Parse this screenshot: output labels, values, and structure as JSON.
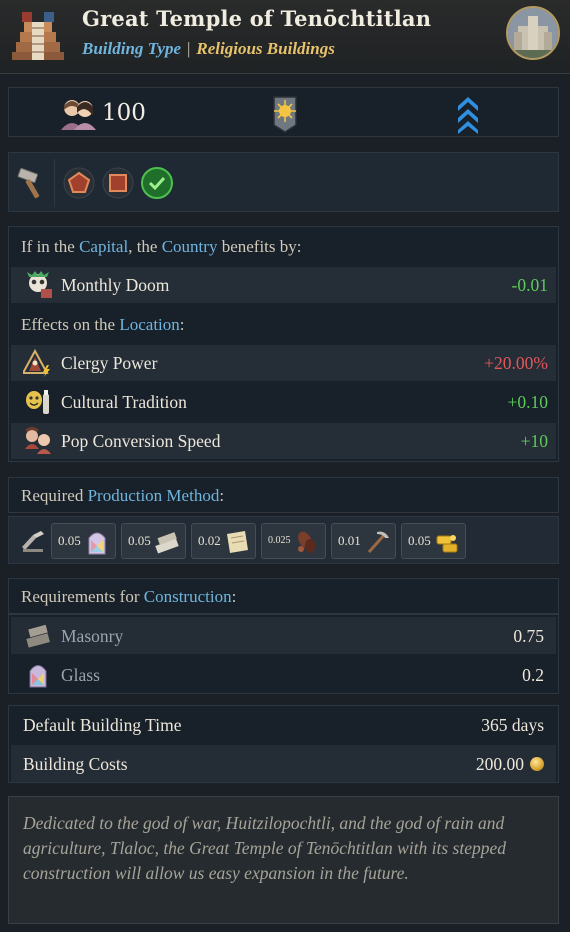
{
  "header": {
    "title": "Great Temple of Tenōchtitlan",
    "type_label": "Building Type",
    "type_value": "Religious Buildings"
  },
  "stats": {
    "population": "100"
  },
  "effects": {
    "capital_prefix": "If in the ",
    "capital_word": "Capital",
    "capital_mid": ", the ",
    "country_word": "Country",
    "capital_suffix": " benefits by:",
    "country_rows": [
      {
        "label": "Monthly Doom",
        "value": "-0.01",
        "icon": "doom-icon"
      }
    ],
    "location_prefix": "Effects on the ",
    "location_word": "Location",
    "location_suffix": ":",
    "location_rows": [
      {
        "label": "Clergy Power",
        "value": "+20.00%",
        "icon": "clergy-icon"
      },
      {
        "label": "Cultural Tradition",
        "value": "+0.10",
        "icon": "culture-icon"
      },
      {
        "label": "Pop Conversion Speed",
        "value": "+10",
        "icon": "conversion-icon"
      }
    ]
  },
  "production": {
    "prefix": "Required ",
    "word": "Production Method",
    "suffix": ":",
    "inputs": [
      {
        "value": "0.05",
        "icon": "glass-icon"
      },
      {
        "value": "0.05",
        "icon": "masonry-icon"
      },
      {
        "value": "0.02",
        "icon": "paper-icon"
      },
      {
        "value": "0.025",
        "icon": "cocoa-icon"
      },
      {
        "value": "0.01",
        "icon": "tools-icon"
      },
      {
        "value": "0.05",
        "icon": "gold-icon"
      }
    ]
  },
  "construction": {
    "prefix": "Requirements for ",
    "word": "Construction",
    "suffix": ":",
    "rows": [
      {
        "label": "Masonry",
        "value": "0.75",
        "icon": "masonry-icon"
      },
      {
        "label": "Glass",
        "value": "0.2",
        "icon": "glass-icon"
      }
    ],
    "time_label": "Default Building Time",
    "time_value": "365 days",
    "cost_label": "Building Costs",
    "cost_value": "200.00"
  },
  "description": "Dedicated to the god of war, Huitzilopochtli, and the god of rain and agriculture, Tlaloc, the Great Temple of Tenōchtitlan with its stepped construction will allow us easy expansion in the future.",
  "colors": {
    "highlight": "#6fb5dd",
    "positive": "#5ecb5b",
    "negative": "#e2585a",
    "gold": "#e8c36b"
  }
}
